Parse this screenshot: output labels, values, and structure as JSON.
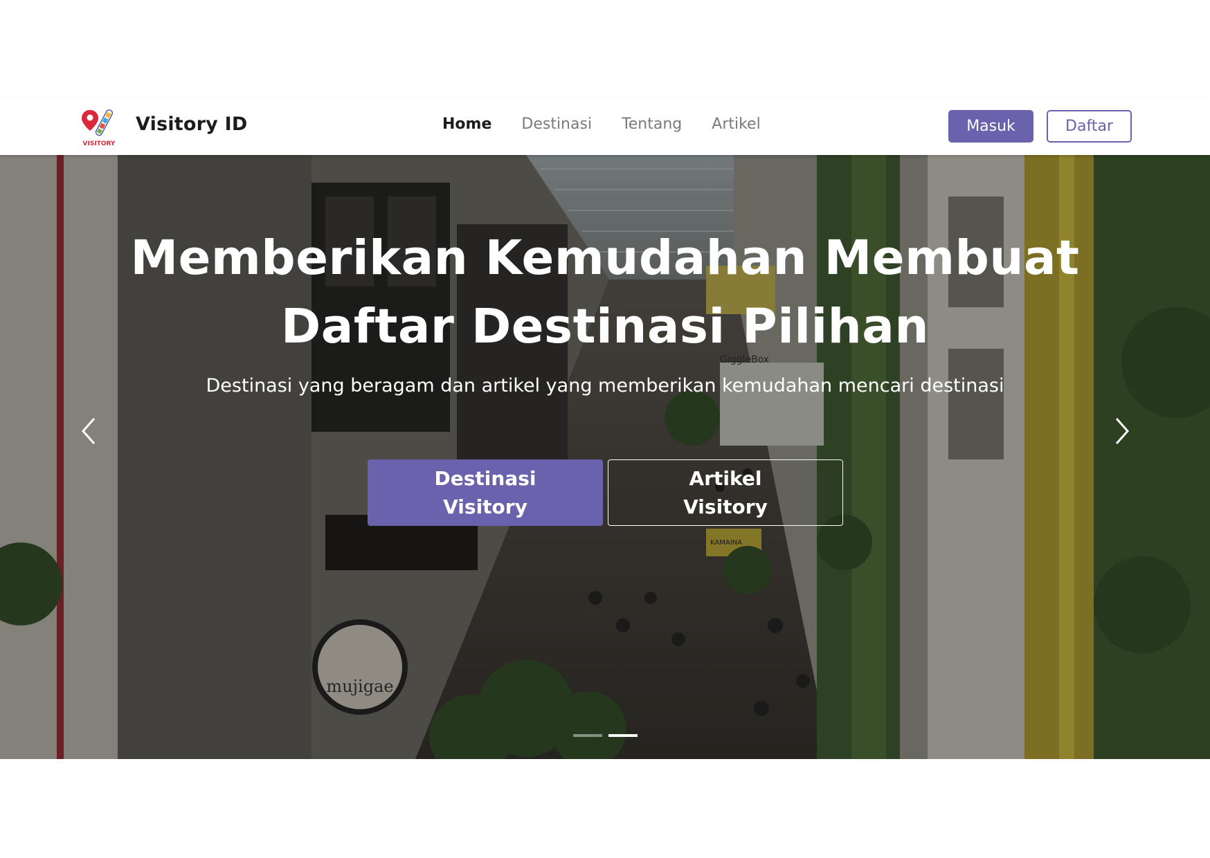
{
  "header": {
    "brand_name": "Visitory ID",
    "logo_text": "VISITORY",
    "nav_links": [
      {
        "label": "Home",
        "active": true
      },
      {
        "label": "Destinasi",
        "active": false
      },
      {
        "label": "Tentang",
        "active": false
      },
      {
        "label": "Artikel",
        "active": false
      }
    ],
    "login_label": "Masuk",
    "register_label": "Daftar"
  },
  "hero": {
    "title": "Memberikan Kemudahan Membuat Daftar Destinasi Pilihan",
    "subtitle": "Destinasi yang beragam dan artikel yang memberikan kemudahan mencari destinasi",
    "primary_button_label": "Destinasi Visitory",
    "secondary_button_label": "Artikel Visitory",
    "prev_icon": "chevron-left-icon",
    "next_icon": "chevron-right-icon",
    "slide_count": 2,
    "active_slide": 2
  },
  "sign_text": {
    "store_sign": "mujigae",
    "gigglebox_sign": "GiggleBox",
    "kamaina_sign": "KAMAINA"
  },
  "colors": {
    "accent": "#6a62ad",
    "nav_active": "#1c1c1c",
    "nav_inactive": "#7a7a7a",
    "logo_red": "#d8283a"
  }
}
